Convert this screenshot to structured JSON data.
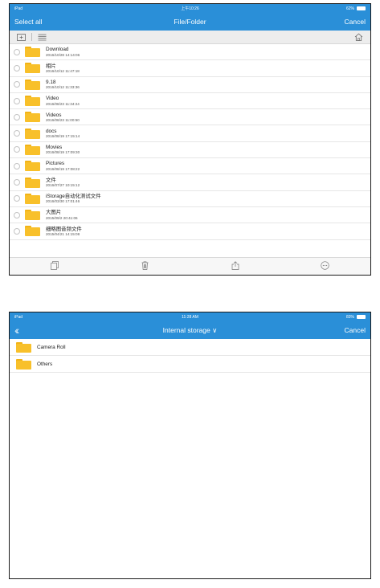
{
  "screen1": {
    "status": {
      "carrier": "iPad",
      "time": "上午10:26",
      "battery": "62%"
    },
    "nav": {
      "left": "Select all",
      "title": "File/Folder",
      "right": "Cancel"
    },
    "files": [
      {
        "name": "Download",
        "date": "2016/10/28 14:14:06"
      },
      {
        "name": "相片",
        "date": "2016/10/12 11:47:18"
      },
      {
        "name": "9.18",
        "date": "2016/10/12 11:33:36"
      },
      {
        "name": "Video",
        "date": "2016/08/23 11:34:24"
      },
      {
        "name": "Videos",
        "date": "2016/08/23 11:00:50"
      },
      {
        "name": "docs",
        "date": "2016/08/19 17:15:14"
      },
      {
        "name": "Movies",
        "date": "2016/08/19 17:09:30"
      },
      {
        "name": "Pictures",
        "date": "2016/08/19 17:08:22"
      },
      {
        "name": "文件",
        "date": "2016/07/27 10:15:12"
      },
      {
        "name": "iStorage自动化测试文件",
        "date": "2016/03/30 17:01:46"
      },
      {
        "name": "大图片",
        "date": "2015/09/2 20:41:06"
      },
      {
        "name": "细略图音频文件",
        "date": "2015/04/21 14:15:08"
      }
    ],
    "bottom_bar": [
      "copy-icon",
      "trash-icon",
      "share-icon",
      "more-icon"
    ]
  },
  "screen2": {
    "status": {
      "carrier": "iPad",
      "time": "11:28 AM",
      "battery": "83%"
    },
    "nav": {
      "title": "Internal storage",
      "right": "Cancel"
    },
    "items": [
      {
        "name": "Camera Roll"
      },
      {
        "name": "Others"
      }
    ]
  },
  "colors": {
    "accent": "#2a8fd8",
    "folder": "#f8c02a"
  }
}
